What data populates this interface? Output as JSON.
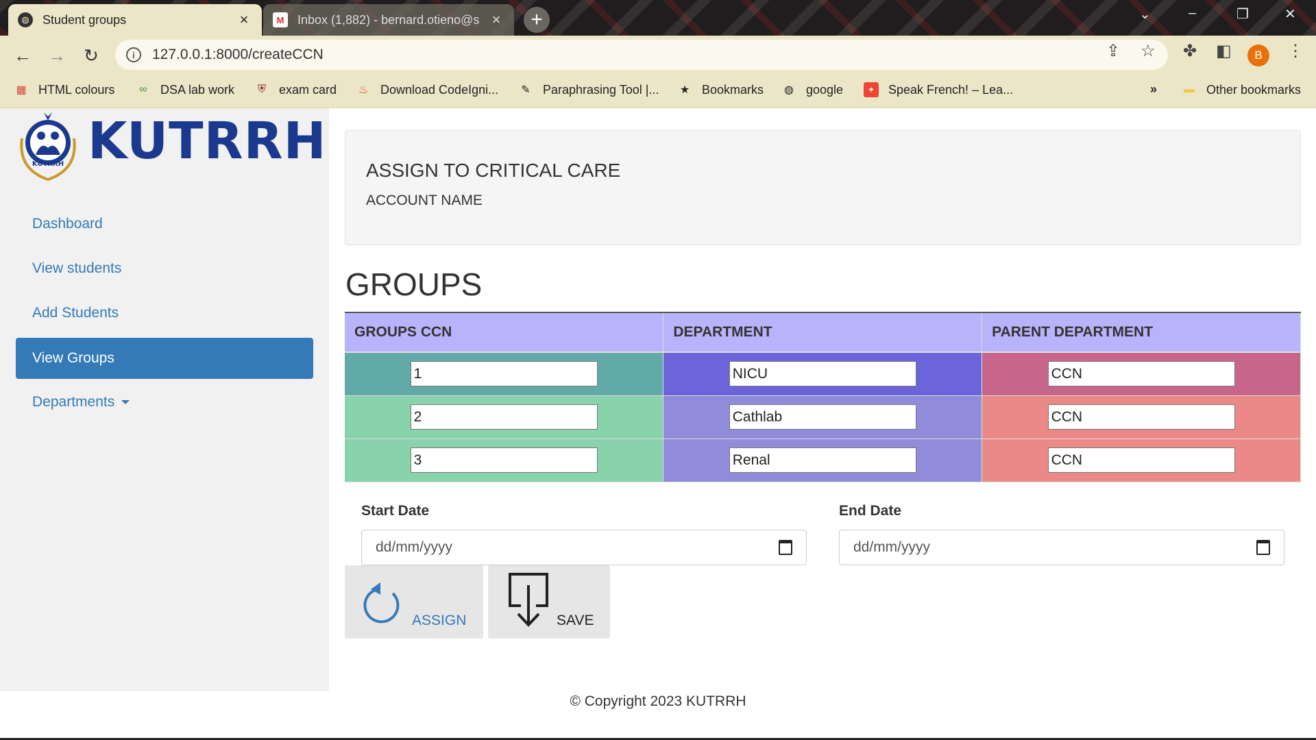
{
  "browser": {
    "tabs": [
      {
        "title": "Student groups",
        "active": true
      },
      {
        "title": "Inbox (1,882) - bernard.otieno@s",
        "active": false
      }
    ],
    "url": "127.0.0.1:8000/createCCN",
    "avatar_letter": "B",
    "bookmarks": [
      {
        "label": "HTML colours",
        "icon": "grid-icon"
      },
      {
        "label": "DSA lab work",
        "icon": "link-icon"
      },
      {
        "label": "exam card",
        "icon": "crest-icon"
      },
      {
        "label": "Download CodeIgni...",
        "icon": "flame-icon"
      },
      {
        "label": "Paraphrasing Tool |...",
        "icon": "feather-icon"
      },
      {
        "label": "Bookmarks",
        "icon": "star-icon"
      },
      {
        "label": "google",
        "icon": "globe-icon"
      },
      {
        "label": "Speak French! – Lea...",
        "icon": "flag-icon"
      }
    ],
    "more_bookmarks": "»",
    "other_bookmarks": "Other bookmarks"
  },
  "brand": {
    "name": "KUTRRH"
  },
  "sidebar": {
    "items": [
      {
        "label": "Dashboard"
      },
      {
        "label": "View students"
      },
      {
        "label": "Add Students"
      },
      {
        "label": "View Groups",
        "active": true
      },
      {
        "label": "Departments",
        "dropdown": true
      }
    ]
  },
  "well": {
    "heading": "ASSIGN TO CRITICAL CARE",
    "subheading": "ACCOUNT NAME"
  },
  "groups": {
    "title": "GROUPS",
    "headers": [
      "GROUPS CCN",
      "DEPARTMENT",
      "PARENT DEPARTMENT"
    ],
    "rows": [
      {
        "ccn": "1",
        "department": "NICU",
        "parent": "CCN"
      },
      {
        "ccn": "2",
        "department": "Cathlab",
        "parent": "CCN"
      },
      {
        "ccn": "3",
        "department": "Renal",
        "parent": "CCN"
      }
    ],
    "colors": {
      "header": "#b8b4fb",
      "row1": [
        "#62aaa8",
        "#6c64db",
        "#c7668a"
      ],
      "row2": [
        "#88d3ac",
        "#908cd9",
        "#ea8985"
      ],
      "row3": [
        "#88d3ac",
        "#908cd9",
        "#ea8985"
      ]
    }
  },
  "dates": {
    "start_label": "Start Date",
    "end_label": "End Date",
    "placeholder": "dd/mm/yyyy"
  },
  "actions": {
    "assign_label": "ASSIGN",
    "save_label": "SAVE"
  },
  "footer": {
    "text": "© Copyright 2023 KUTRRH"
  }
}
